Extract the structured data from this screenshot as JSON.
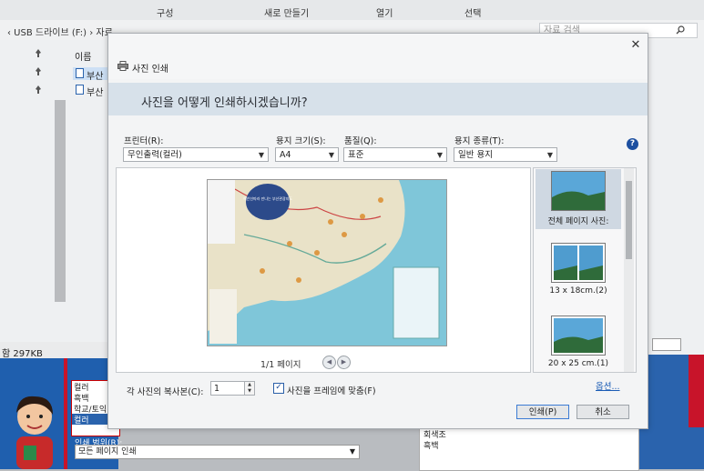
{
  "explorer": {
    "ribbon": {
      "organize": "구성",
      "new": "새로 만들기",
      "open": "열기",
      "select": "선택"
    },
    "address": "‹ USB 드라이브 (F:) › 자료",
    "search_placeholder": "자료 검색",
    "column_name": "이름",
    "files": [
      "부산",
      "부산"
    ],
    "status_size": "함 297KB"
  },
  "background_form": {
    "color_options": [
      "컬러",
      "흑백",
      "학교/토익",
      "컬러"
    ],
    "range_label": "인쇄 범위(R):",
    "range_value": "모든 페이지 인쇄",
    "right_options": [
      "회색조",
      "흑백"
    ]
  },
  "dialog": {
    "title": "사진 인쇄",
    "heading": "사진을 어떻게 인쇄하시겠습니까?",
    "close_glyph": "✕",
    "printer": {
      "label": "프린터(R):",
      "value": "무인출력(컬러)"
    },
    "paper_size": {
      "label": "용지 크기(S):",
      "value": "A4"
    },
    "quality": {
      "label": "품질(Q):",
      "value": "표준"
    },
    "paper_type": {
      "label": "용지 종류(T):",
      "value": "일반 용지"
    },
    "help_glyph": "?",
    "preview": {
      "page_info": "1/1 페이지",
      "map_title": "해안선따라 만나는 부산관광지도"
    },
    "layouts": [
      {
        "caption": "전체 페이지 사진:",
        "selected": true
      },
      {
        "caption": "13 x 18cm.(2)",
        "selected": false
      },
      {
        "caption": "20 x 25 cm.(1)",
        "selected": false
      }
    ],
    "copies": {
      "label": "각 사진의 복사본(C):",
      "value": "1"
    },
    "fit_frame": {
      "label": "사진을 프레임에 맞춤(F)",
      "checked": true,
      "check_glyph": "✓"
    },
    "options_link": "옵션...",
    "buttons": {
      "print": "인쇄(P)",
      "cancel": "취소"
    }
  },
  "colors": {
    "accent": "#1c4fa0",
    "banner": "#d7e1ea",
    "sea": "#7fc6d9",
    "land": "#e9e2c8"
  },
  "icons": {
    "close": "close-icon",
    "help": "help-icon",
    "printer": "printer-icon",
    "pin": "pin-icon",
    "file": "file-icon",
    "search": "search-icon"
  }
}
